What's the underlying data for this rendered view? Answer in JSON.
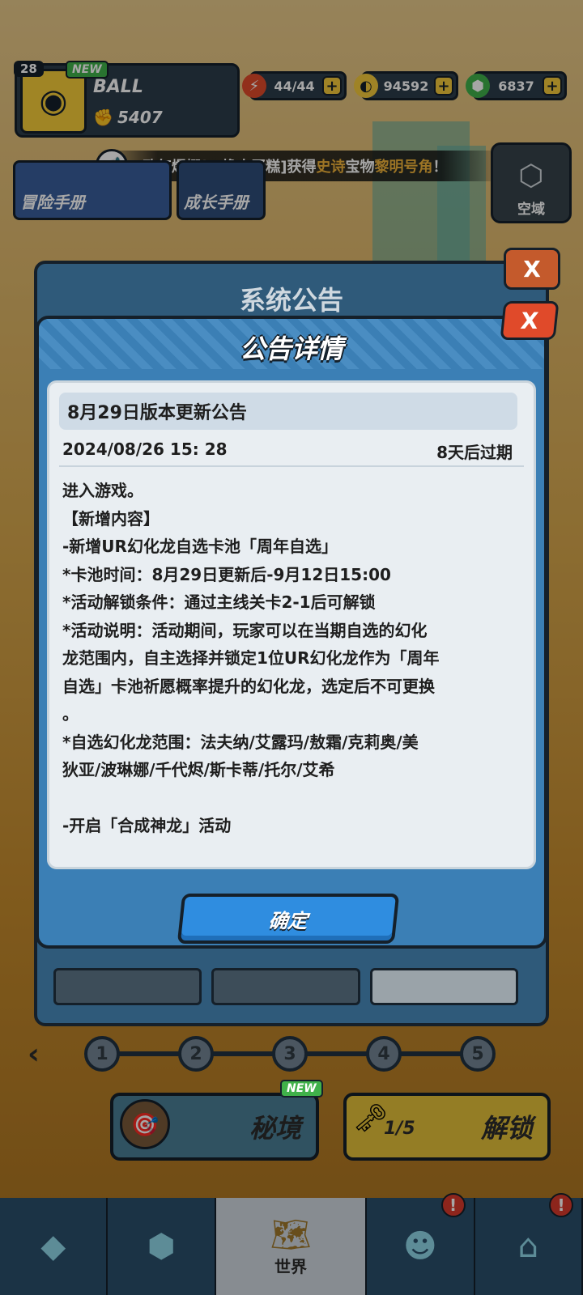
{
  "player": {
    "level": "28",
    "new_badge": "NEW",
    "name": "BALL",
    "power": "5407"
  },
  "resources": [
    {
      "name": "energy",
      "icon": "lightning-icon",
      "value": "44/44",
      "color": "#e04a2a"
    },
    {
      "name": "gold",
      "icon": "coin-icon",
      "value": "94592",
      "color": "#f4c93b"
    },
    {
      "name": "gems",
      "icon": "gem-icon",
      "value": "6837",
      "color": "#40b14a"
    }
  ],
  "marquee": {
    "prefix": "欧气爆棚！[橡木蛋糕]获得",
    "rarity": "史诗",
    "middle": "宝物",
    "item": "黎明号角",
    "suffix": "！"
  },
  "side_buttons": {
    "adventure": "冒险手册",
    "growth": "成长手册",
    "airspace": "空域"
  },
  "system_dialog": {
    "title": "系统公告",
    "close": "X"
  },
  "pager": {
    "pages": [
      "1",
      "2",
      "3",
      "4",
      "5"
    ],
    "prev": "‹"
  },
  "panels": {
    "secret_new": "NEW",
    "secret": "秘境",
    "unlock": "解锁",
    "key_count": "1/5"
  },
  "bottom_nav": {
    "world": "世界",
    "alert": "!"
  },
  "detail": {
    "title": "公告详情",
    "close": "X",
    "card_title": "8月29日版本更新公告",
    "date": "2024/08/26 15: 28",
    "expire": "8天后过期",
    "lines": [
      "进入游戏。",
      "【新增内容】",
      "-新增UR幻化龙自选卡池「周年自选」",
      "*卡池时间：8月29日更新后-9月12日15:00",
      "*活动解锁条件：通过主线关卡2-1后可解锁",
      "*活动说明：活动期间，玩家可以在当期自选的幻化",
      "龙范围内，自主选择并锁定1位UR幻化龙作为「周年",
      "自选」卡池祈愿概率提升的幻化龙，选定后不可更换",
      "。",
      "*自选幻化龙范围：法夫纳/艾露玛/敖霜/克莉奥/美",
      "狄亚/波琳娜/千代烬/斯卡蒂/托尔/艾希",
      "",
      "-开启「合成神龙」活动"
    ],
    "confirm": "确定"
  }
}
